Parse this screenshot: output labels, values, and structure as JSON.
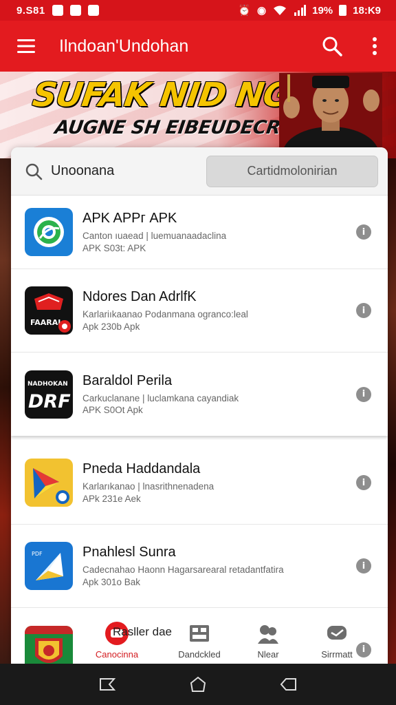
{
  "status_bar": {
    "time_left": "9.S81",
    "time_right": "18:K9",
    "battery": "19%"
  },
  "app_bar": {
    "title": "Ilndoan'Undohan"
  },
  "banner": {
    "title": "SUFAK NID NGIAI",
    "subtitle": "AUGNE SH EIBEUDECRYAMT!"
  },
  "search": {
    "value": "Unoonana",
    "button_label": "Cartidmolonirian"
  },
  "apps": [
    {
      "name": "APK APPг APK",
      "desc": "Canton ıuaead | luemuanaadaclina",
      "meta": "APK  S03t:  APK",
      "icon": "globe-app-icon",
      "color": "#1a7fd6"
    },
    {
      "name": "Ndores Dan AdrlfK",
      "desc": "Karlariıkaanao Podanmana ogranco:leal",
      "meta": "Apk  230b  Apk",
      "icon": "shield-app-icon",
      "color": "#111111"
    },
    {
      "name": "Baraldol Perila",
      "desc": "Carkuclanane | luclamkana cayandiak",
      "meta": "APK  S0Ot  Apk",
      "icon": "drf-app-icon",
      "color": "#111111"
    },
    {
      "name": "Pneda Haddandala",
      "desc": "Karlarıkanao | lnasrithnenadena",
      "meta": "APk  231e  Aek",
      "icon": "paper-plane-app-icon",
      "color": "#f2c230"
    },
    {
      "name": "Pnahlesl Sunra",
      "desc": "Cadecnahao Haonn Hagarsarearal retadantfatira",
      "meta": "Apk  301o  Bak",
      "icon": "paper-note-app-icon",
      "color": "#1976d2"
    },
    {
      "name": "",
      "desc": "",
      "meta": "",
      "icon": "emblem-app-icon",
      "color": "#1a8a3a"
    }
  ],
  "tabs": [
    {
      "label": "Canocinna",
      "icon": "youtube-icon",
      "active": true
    },
    {
      "label": "Dandckled",
      "icon": "grid-icon",
      "active": false
    },
    {
      "label": "Nlear",
      "icon": "people-icon",
      "active": false
    },
    {
      "label": "Sirrmatt",
      "icon": "chat-icon",
      "active": false
    }
  ],
  "tab_extra_label": "Rasller dae",
  "colors": {
    "brand_red": "#e31b1f",
    "statusbar_red": "#d6141a",
    "nav_black": "#1a1a1a"
  }
}
